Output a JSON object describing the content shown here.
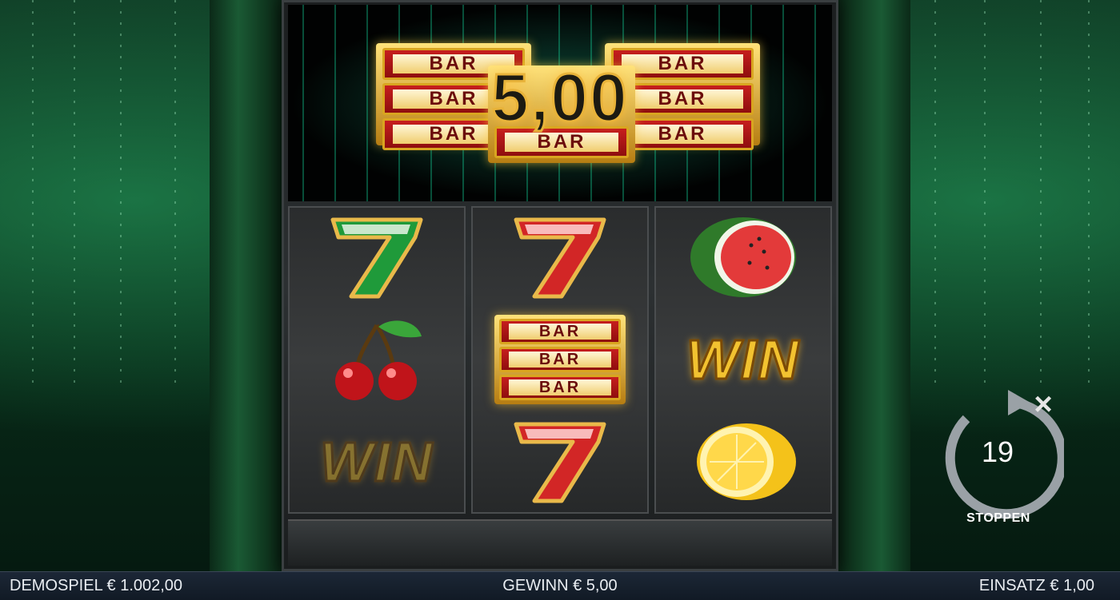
{
  "jackpot_display": {
    "amount": "5,00"
  },
  "logo": {
    "bar_text": "BAR"
  },
  "reels": [
    {
      "symbols": [
        "seven-green",
        "cherry",
        "win"
      ]
    },
    {
      "symbols": [
        "seven-red",
        "bar-bar-bar",
        "seven-red"
      ]
    },
    {
      "symbols": [
        "watermelon",
        "win",
        "lemon"
      ]
    }
  ],
  "symbol_text": {
    "win": "WIN",
    "bar": "BAR"
  },
  "autoplay": {
    "remaining": "19",
    "label": "STOPPEN",
    "stop_icon": "close-icon"
  },
  "status": {
    "balance": "DEMOSPIEL € 1.002,00",
    "win": "GEWINN € 5,00",
    "bet": "EINSATZ € 1,00"
  },
  "colors": {
    "background_green": "#0f3a24",
    "gold": "#e8b33a",
    "bar_red": "#c61e1e",
    "statusbar": "#1c2736"
  }
}
